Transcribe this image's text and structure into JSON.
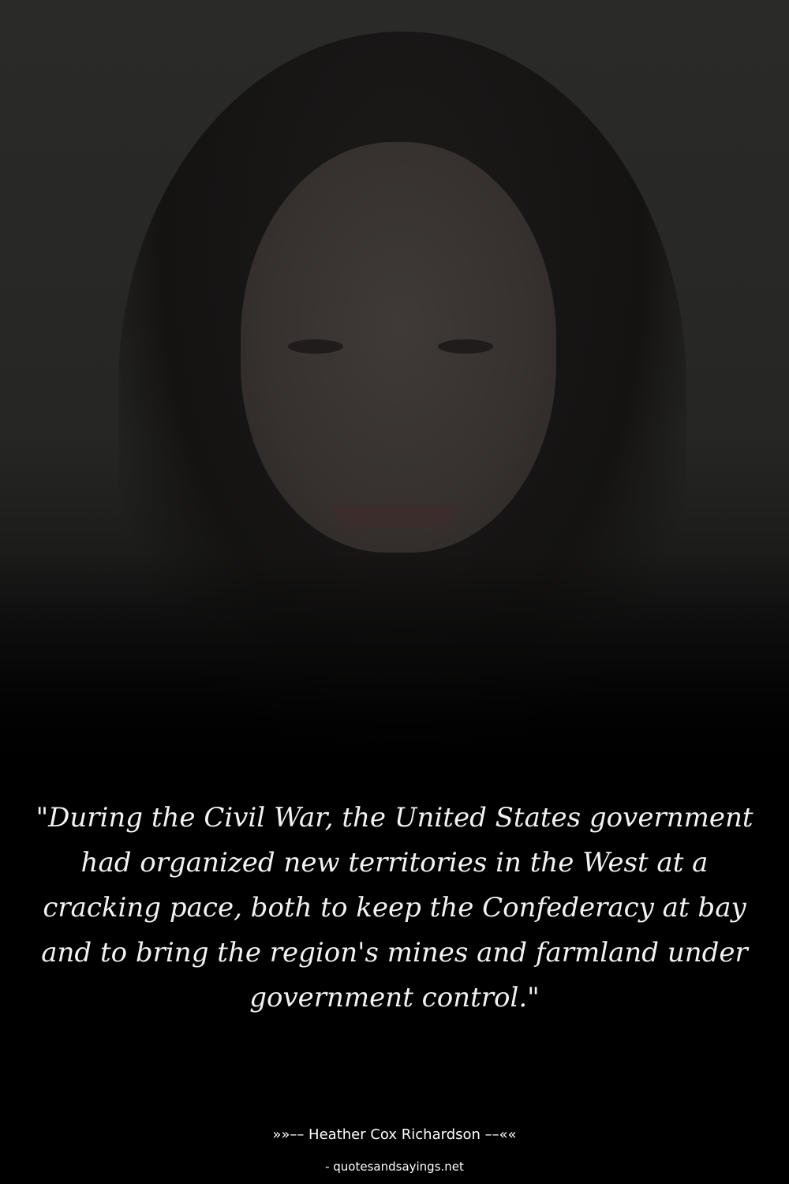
{
  "quote": {
    "text": "\"During the Civil War, the United States government had organized new territories in the West at a cracking pace, both to keep the Confederacy at bay and to bring the region's mines and farmland under government control.\""
  },
  "author": {
    "line": "»»–– Heather Cox Richardson ––««"
  },
  "source": {
    "site": "- quotesandsayings.net"
  },
  "colors": {
    "background": "#000000",
    "text": "#f2f2f2"
  }
}
